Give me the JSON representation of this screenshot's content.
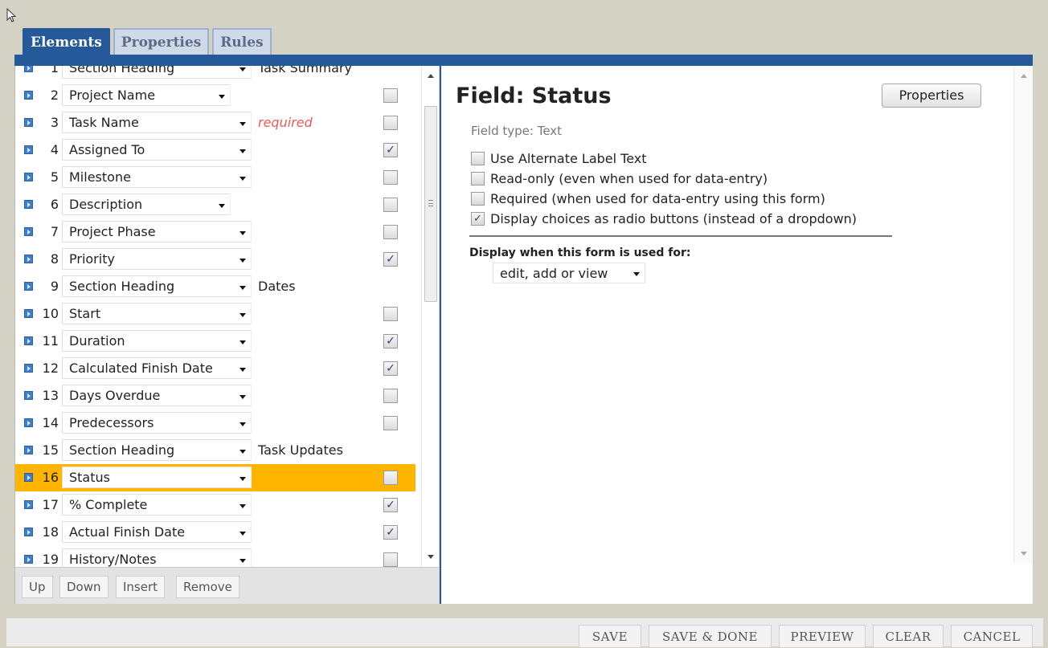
{
  "tabs": [
    "Elements",
    "Properties",
    "Rules"
  ],
  "rows": [
    {
      "num": "1",
      "label": "Section Heading",
      "note": "Task Summary",
      "note_style": "",
      "checkbox": false
    },
    {
      "num": "2",
      "label": "Project Name",
      "note": "",
      "note_style": "",
      "checkbox": true,
      "checked": false
    },
    {
      "num": "3",
      "label": "Task Name",
      "note": "required",
      "note_style": "req",
      "checkbox": true,
      "checked": false
    },
    {
      "num": "4",
      "label": "Assigned To",
      "note": "",
      "note_style": "",
      "checkbox": true,
      "checked": true
    },
    {
      "num": "5",
      "label": "Milestone",
      "note": "",
      "note_style": "",
      "checkbox": true,
      "checked": false
    },
    {
      "num": "6",
      "label": "Description",
      "note": "",
      "note_style": "",
      "checkbox": true,
      "checked": false
    },
    {
      "num": "7",
      "label": "Project Phase",
      "note": "",
      "note_style": "",
      "checkbox": true,
      "checked": false
    },
    {
      "num": "8",
      "label": "Priority",
      "note": "",
      "note_style": "",
      "checkbox": true,
      "checked": true
    },
    {
      "num": "9",
      "label": "Section Heading",
      "note": "Dates",
      "note_style": "",
      "checkbox": false
    },
    {
      "num": "10",
      "label": "Start",
      "note": "",
      "note_style": "",
      "checkbox": true,
      "checked": false
    },
    {
      "num": "11",
      "label": "Duration",
      "note": "",
      "note_style": "",
      "checkbox": true,
      "checked": true
    },
    {
      "num": "12",
      "label": "Calculated Finish Date",
      "note": "",
      "note_style": "",
      "checkbox": true,
      "checked": true
    },
    {
      "num": "13",
      "label": "Days Overdue",
      "note": "",
      "note_style": "",
      "checkbox": true,
      "checked": false
    },
    {
      "num": "14",
      "label": "Predecessors",
      "note": "",
      "note_style": "",
      "checkbox": true,
      "checked": false
    },
    {
      "num": "15",
      "label": "Section Heading",
      "note": "Task Updates",
      "note_style": "",
      "checkbox": false
    },
    {
      "num": "16",
      "label": "Status",
      "note": "",
      "note_style": "",
      "checkbox": true,
      "checked": false,
      "selected": true
    },
    {
      "num": "17",
      "label": "% Complete",
      "note": "",
      "note_style": "",
      "checkbox": true,
      "checked": true
    },
    {
      "num": "18",
      "label": "Actual Finish Date",
      "note": "",
      "note_style": "",
      "checkbox": true,
      "checked": true
    },
    {
      "num": "19",
      "label": "History/Notes",
      "note": "",
      "note_style": "",
      "checkbox": true,
      "checked": false
    }
  ],
  "left_buttons": [
    "Up",
    "Down",
    "Insert",
    "Remove"
  ],
  "field": {
    "title": "Field: Status",
    "properties_button": "Properties",
    "type_text": "Field type: Text",
    "options": [
      {
        "label": "Use Alternate Label Text",
        "checked": false
      },
      {
        "label": "Read-only (even when used for data-entry)",
        "checked": false
      },
      {
        "label": "Required (when used for data-entry using this form)",
        "checked": false
      },
      {
        "label": "Display choices as radio buttons (instead of a dropdown)",
        "checked": true
      }
    ],
    "display_label": "Display when this form is used for:",
    "display_value": "edit, add or view"
  },
  "bottom_buttons": [
    "SAVE",
    "SAVE & DONE",
    "PREVIEW",
    "CLEAR",
    "CANCEL"
  ]
}
